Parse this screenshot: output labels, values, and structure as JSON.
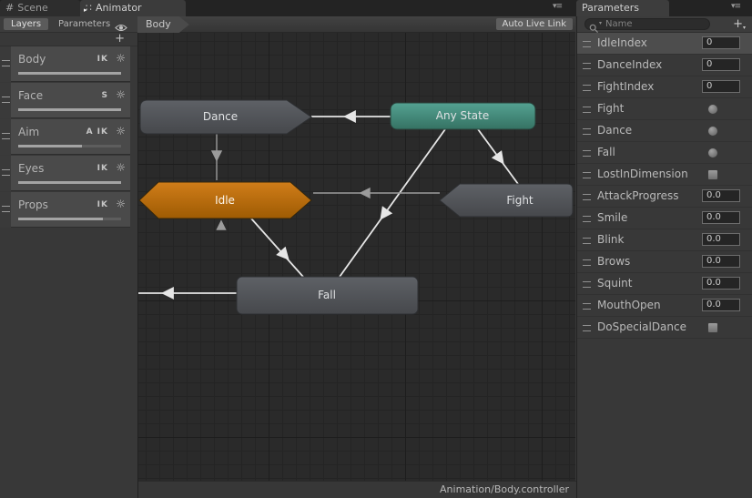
{
  "window": {
    "tabs": [
      {
        "label": "Scene"
      },
      {
        "label": "Animator"
      }
    ],
    "menu_icon": "▾≡"
  },
  "layers_panel": {
    "layers_tab": "Layers",
    "parameters_tab": "Parameters",
    "add_button": "+",
    "layers": [
      {
        "name": "Body",
        "badges": "IK",
        "weight": 1.0
      },
      {
        "name": "Face",
        "badges": "S",
        "weight": 1.0
      },
      {
        "name": "Aim",
        "badges": "A IK",
        "weight": 0.62
      },
      {
        "name": "Eyes",
        "badges": "IK",
        "weight": 1.0
      },
      {
        "name": "Props",
        "badges": "IK",
        "weight": 0.82
      }
    ]
  },
  "graph": {
    "breadcrumb": "Body",
    "auto_live_link": "Auto Live Link",
    "status_bar": "Animation/Body.controller",
    "nodes": [
      {
        "label": "Dance",
        "type": "state"
      },
      {
        "label": "Any State",
        "type": "any-state",
        "color": "#4f9d8d"
      },
      {
        "label": "Idle",
        "type": "default-state",
        "color": "#c9760f"
      },
      {
        "label": "Fight",
        "type": "state"
      },
      {
        "label": "Fall",
        "type": "state"
      }
    ],
    "transitions": [
      {
        "from": "Any State",
        "to": "Dance"
      },
      {
        "from": "Dance",
        "to": "Idle"
      },
      {
        "from": "Fight",
        "to": "Idle"
      },
      {
        "from": "Any State",
        "to": "Fall"
      },
      {
        "from": "Any State",
        "to": "Fight"
      },
      {
        "from": "Idle",
        "to": "Fall"
      },
      {
        "from": "Fall",
        "to": "offscreen-left"
      },
      {
        "from": "Fall",
        "to": "Idle"
      }
    ]
  },
  "parameters_panel": {
    "tab": "Parameters",
    "search_placeholder": "Name",
    "add_button": "+",
    "rows": [
      {
        "name": "IdleIndex",
        "type": "int",
        "value": "0",
        "selected": true
      },
      {
        "name": "DanceIndex",
        "type": "int",
        "value": "0"
      },
      {
        "name": "FightIndex",
        "type": "int",
        "value": "0"
      },
      {
        "name": "Fight",
        "type": "trigger"
      },
      {
        "name": "Dance",
        "type": "trigger"
      },
      {
        "name": "Fall",
        "type": "trigger"
      },
      {
        "name": "LostInDimension",
        "type": "bool",
        "value": false
      },
      {
        "name": "AttackProgress",
        "type": "float",
        "value": "0.0"
      },
      {
        "name": "Smile",
        "type": "float",
        "value": "0.0"
      },
      {
        "name": "Blink",
        "type": "float",
        "value": "0.0"
      },
      {
        "name": "Brows",
        "type": "float",
        "value": "0.0"
      },
      {
        "name": "Squint",
        "type": "float",
        "value": "0.0"
      },
      {
        "name": "MouthOpen",
        "type": "float",
        "value": "0.0"
      },
      {
        "name": "DoSpecialDance",
        "type": "bool",
        "value": false
      }
    ]
  },
  "colors": {
    "graph_bg": "#2a2a2a",
    "panel_bg": "#383838",
    "any_state": "#4f9d8d",
    "default_state": "#c9760f",
    "state_gray": "#55585d",
    "edge_white": "#e6e6e6",
    "edge_gray": "#9b9b9b"
  }
}
